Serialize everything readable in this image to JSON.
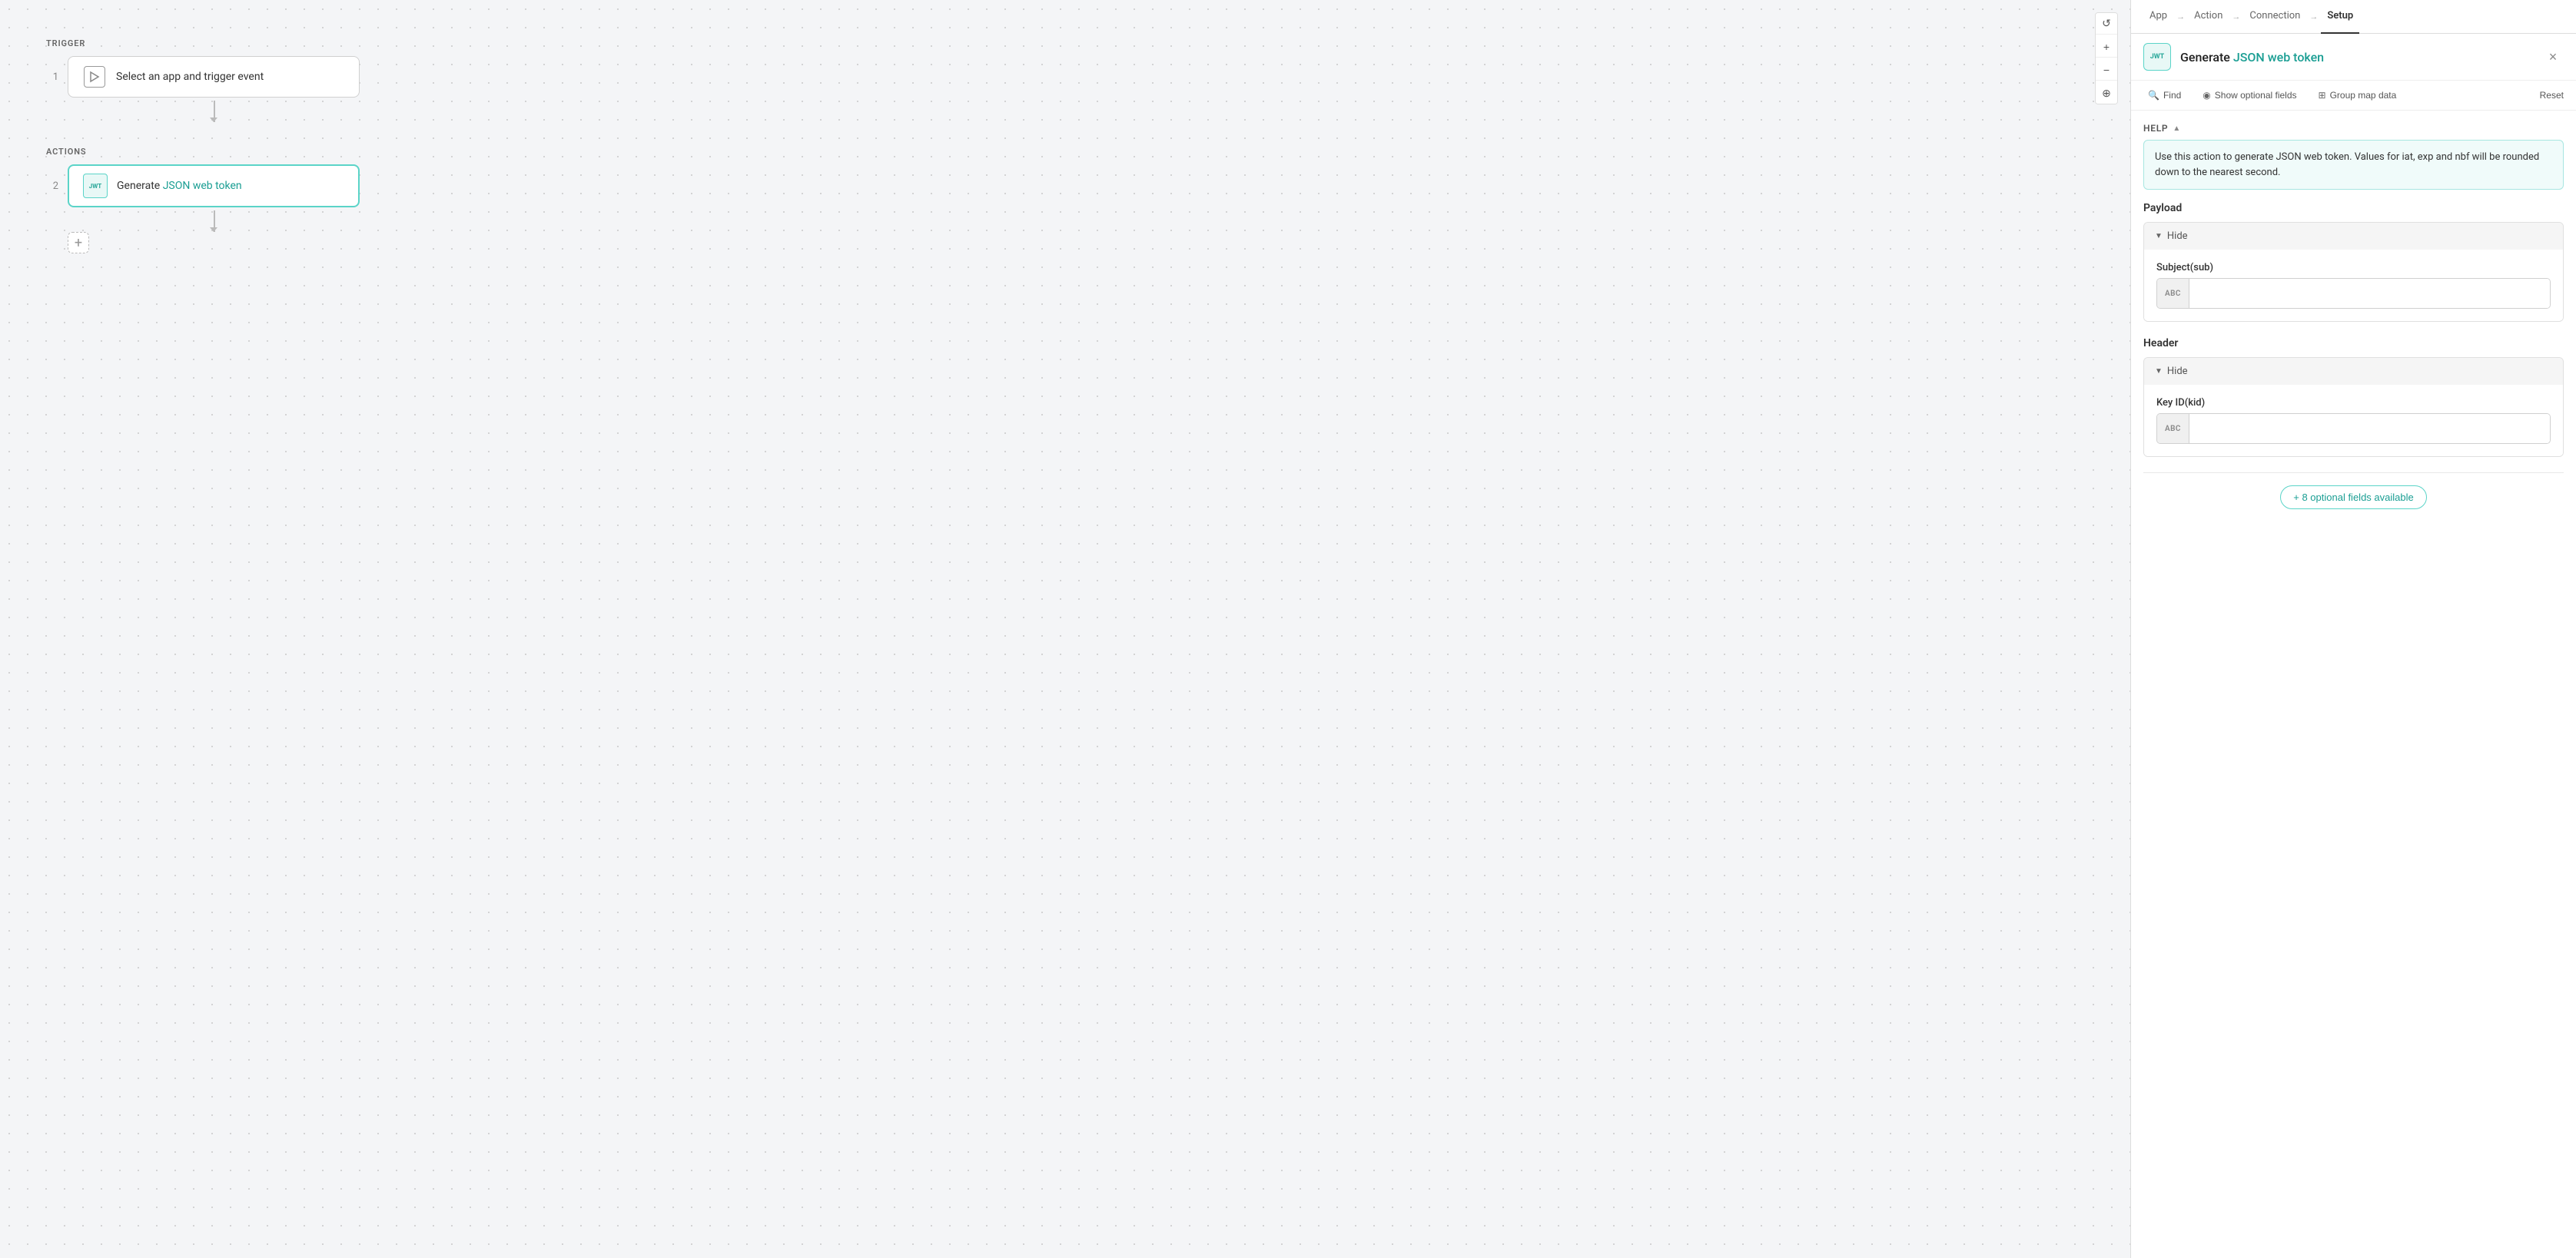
{
  "canvas": {
    "trigger_label": "TRIGGER",
    "actions_label": "ACTIONS",
    "step1_number": "1",
    "step1_label": "Select an app and trigger event",
    "step2_number": "2",
    "step2_prefix": "Generate ",
    "step2_highlight": "JSON web token",
    "add_button_label": "+"
  },
  "canvas_controls": {
    "reset_icon": "↺",
    "zoom_in_icon": "+",
    "zoom_out_icon": "−",
    "crosshair_icon": "⊕"
  },
  "panel": {
    "tabs": [
      {
        "label": "App",
        "active": false
      },
      {
        "label": "Action",
        "active": false
      },
      {
        "label": "Connection",
        "active": false
      },
      {
        "label": "Setup",
        "active": true
      }
    ],
    "title_prefix": "Generate ",
    "title_highlight": "JSON web token",
    "close_icon": "×",
    "toolbar": {
      "find_icon": "🔍",
      "find_label": "Find",
      "optional_icon": "◉",
      "optional_label": "Show optional fields",
      "group_icon": "⊞",
      "group_label": "Group map data",
      "reset_label": "Reset"
    },
    "help": {
      "label": "HELP",
      "chevron": "▲",
      "text": "Use this action to generate JSON web token. Values for iat, exp and nbf will be rounded down to the nearest second."
    },
    "payload": {
      "section_title": "Payload",
      "collapse_label": "Hide",
      "subject_label": "Subject(sub)",
      "subject_badge": "ABC",
      "subject_placeholder": ""
    },
    "header": {
      "section_title": "Header",
      "collapse_label": "Hide",
      "keyid_label": "Key ID(kid)",
      "keyid_badge": "ABC",
      "keyid_placeholder": ""
    },
    "optional_fields": {
      "count": "8",
      "label": "+ 8 optional fields available"
    }
  }
}
